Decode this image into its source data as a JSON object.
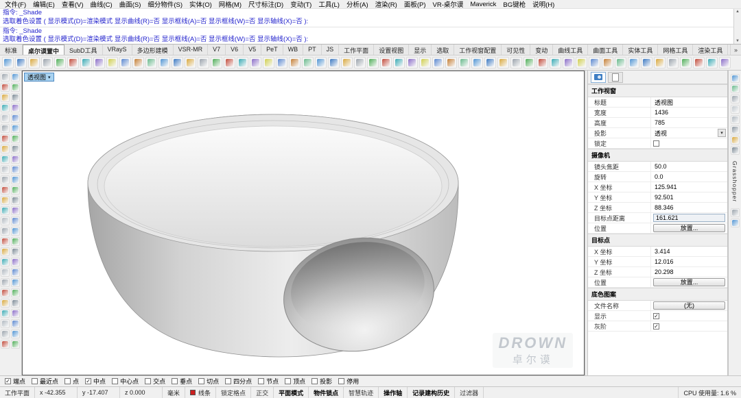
{
  "menu": {
    "items": [
      "文件(F)",
      "编辑(E)",
      "查看(V)",
      "曲线(C)",
      "曲面(S)",
      "细分物件(S)",
      "实体(O)",
      "网格(M)",
      "尺寸标注(D)",
      "变动(T)",
      "工具(L)",
      "分析(A)",
      "渲染(R)",
      "面板(P)",
      "VR-桌尔谟",
      "Maverick",
      "BG键枪",
      "说明(H)"
    ]
  },
  "command": {
    "lines": [
      "指令: _Shade",
      "选取着色设置 ( 显示模式(D)=渲染模式  显示曲线(R)=否  显示框线(A)=否  显示框线(W)=否  显示轴线(X)=否 ):",
      "指令: _Shade",
      "选取着色设置 ( 显示模式(D)=渲染模式  显示曲线(R)=否  显示框线(A)=否  显示框线(W)=否  显示轴线(X)=否 ):"
    ]
  },
  "tab_bar": {
    "active_index": 1,
    "tabs": [
      "标准",
      "桌尔谟置中",
      "SubD工具",
      "VRayS",
      "多边形建模",
      "VSR-MR",
      "V7",
      "V6",
      "V5",
      "PeT",
      "WB",
      "PT",
      "JS",
      "工作平面",
      "设置视图",
      "显示",
      "选取",
      "工作视窗配置",
      "可见性",
      "变动",
      "曲线工具",
      "曲面工具",
      "实体工具",
      "网格工具",
      "渲染工具"
    ],
    "overflow_glyph": "»"
  },
  "top_toolbar": {
    "icon_count": 56,
    "palette": [
      "#4f94d4",
      "#3a78c2",
      "#d9a83c",
      "#9aa3ac",
      "#4fae58",
      "#c24a3a",
      "#38aab4",
      "#8a6cc8",
      "#d0cf4e",
      "#5a87d0",
      "#c57f35",
      "#67b98b"
    ]
  },
  "left_toolbar": {
    "icon_count": 54,
    "palette": [
      "#9aa3ac",
      "#4f94d4",
      "#c24a3a",
      "#4fae58",
      "#d9a83c",
      "#7a8894",
      "#38aab4",
      "#8a6cc8",
      "#b0b8c0",
      "#5a87d0"
    ]
  },
  "right_strip": {
    "vertical_label": "Grasshopper"
  },
  "right_strip_top": {
    "icon_count": 8,
    "palette": [
      "#4f94d4",
      "#67b98b",
      "#9aa3ac",
      "#c2c8ce",
      "#b0b8c0",
      "#8a95a0",
      "#d9a83c",
      "#7a8894"
    ]
  },
  "right_strip_bottom": {
    "icon_count": 2,
    "palette": [
      "#9aa3ac",
      "#4f94d4"
    ]
  },
  "viewport": {
    "title": "透视图",
    "watermark": {
      "line1": "DROWN",
      "line2": "卓尔谟"
    }
  },
  "panel": {
    "sections": [
      {
        "title": "工作视窗",
        "rows": [
          {
            "label": "标题",
            "value": "透视图",
            "type": "text"
          },
          {
            "label": "宽度",
            "value": "1436",
            "type": "text"
          },
          {
            "label": "高度",
            "value": "785",
            "type": "text"
          },
          {
            "label": "投影",
            "value": "透视",
            "type": "select"
          },
          {
            "label": "锁定",
            "type": "checkbox",
            "checked": false
          }
        ]
      },
      {
        "title": "摄像机",
        "rows": [
          {
            "label": "镜头焦距",
            "value": "50.0",
            "type": "text"
          },
          {
            "label": "旋转",
            "value": "0.0",
            "type": "text"
          },
          {
            "label": "X 坐标",
            "value": "125.941",
            "type": "text"
          },
          {
            "label": "Y 坐标",
            "value": "92.501",
            "type": "text"
          },
          {
            "label": "Z 坐标",
            "value": "88.346",
            "type": "text"
          },
          {
            "label": "目标点距离",
            "value": "161.621",
            "type": "input"
          },
          {
            "label": "位置",
            "value": "放置...",
            "type": "button"
          }
        ]
      },
      {
        "title": "目标点",
        "rows": [
          {
            "label": "X 坐标",
            "value": "3.414",
            "type": "text"
          },
          {
            "label": "Y 坐标",
            "value": "12.016",
            "type": "text"
          },
          {
            "label": "Z 坐标",
            "value": "20.298",
            "type": "text"
          },
          {
            "label": "位置",
            "value": "放置...",
            "type": "button"
          }
        ]
      },
      {
        "title": "底色图案",
        "rows": [
          {
            "label": "文件名称",
            "value": "(无)",
            "type": "button"
          },
          {
            "label": "显示",
            "type": "checkbox",
            "checked": true
          },
          {
            "label": "灰阶",
            "type": "checkbox",
            "checked": true
          }
        ]
      }
    ]
  },
  "osnap": {
    "items": [
      {
        "label": "端点",
        "checked": true
      },
      {
        "label": "最近点",
        "checked": false
      },
      {
        "label": "点",
        "checked": false
      },
      {
        "label": "中点",
        "checked": true
      },
      {
        "label": "中心点",
        "checked": false
      },
      {
        "label": "交点",
        "checked": false
      },
      {
        "label": "垂点",
        "checked": false
      },
      {
        "label": "切点",
        "checked": false
      },
      {
        "label": "四分点",
        "checked": false
      },
      {
        "label": "节点",
        "checked": false
      },
      {
        "label": "顶点",
        "checked": false
      },
      {
        "label": "投影",
        "checked": false
      },
      {
        "label": "停用",
        "checked": false
      }
    ]
  },
  "status_bar": {
    "plane": "工作平面",
    "x": "x -42.355",
    "y": "y -17.407",
    "z": "z 0.000",
    "units": "毫米",
    "layer": {
      "label": "线条",
      "color": "#cc2020"
    },
    "toggles": [
      {
        "label": "锁定格点",
        "active": false
      },
      {
        "label": "正交",
        "active": false
      },
      {
        "label": "平面模式",
        "active": true
      },
      {
        "label": "物件锁点",
        "active": true
      },
      {
        "label": "智慧轨迹",
        "active": false
      },
      {
        "label": "操作轴",
        "active": true
      },
      {
        "label": "记录建构历史",
        "active": true
      },
      {
        "label": "过滤器",
        "active": false
      }
    ],
    "cpu": "CPU 使用量: 1.6 %"
  },
  "colors": {
    "command_text": "#2323cd",
    "viewport_label_bg": "#a9d3f1",
    "panel_section_bg": "#efefef",
    "layer_swatch": "#cc2020"
  }
}
